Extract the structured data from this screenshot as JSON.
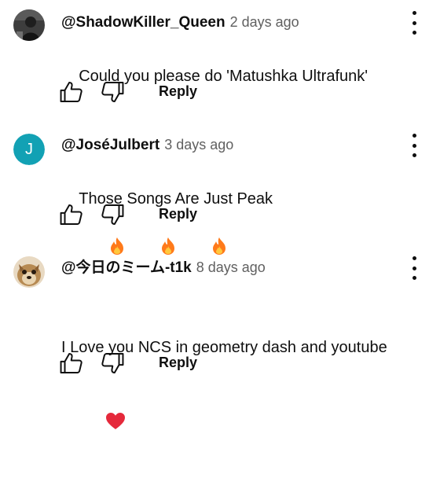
{
  "comments": [
    {
      "handle": "@ShadowKiller_Queen",
      "time": "2 days ago",
      "text": "Could you please do 'Matushka Ultrafunk'",
      "reply_label": "Reply",
      "avatar": {
        "type": "image",
        "icon": "dark-photo-avatar"
      }
    },
    {
      "handle": "@JoséJulbert",
      "time": "3 days ago",
      "text": "Those Songs Are Just Peak",
      "emojis": [
        "fire",
        "fire",
        "fire"
      ],
      "reply_label": "Reply",
      "avatar": {
        "type": "letter",
        "letter": "J",
        "color": "#12a1b4"
      }
    },
    {
      "handle": "@今日のミーム-t1k",
      "time": "8 days ago",
      "text": "I Love you NCS in geometry dash and youtube",
      "emojis": [
        "red-heart"
      ],
      "reply_label": "Reply",
      "avatar": {
        "type": "image",
        "icon": "dog-photo-avatar"
      }
    }
  ],
  "colors": {
    "text": "#0f0f0f",
    "secondary_text": "#606060",
    "fire": "#ff7a1a",
    "heart": "#e5293b"
  }
}
